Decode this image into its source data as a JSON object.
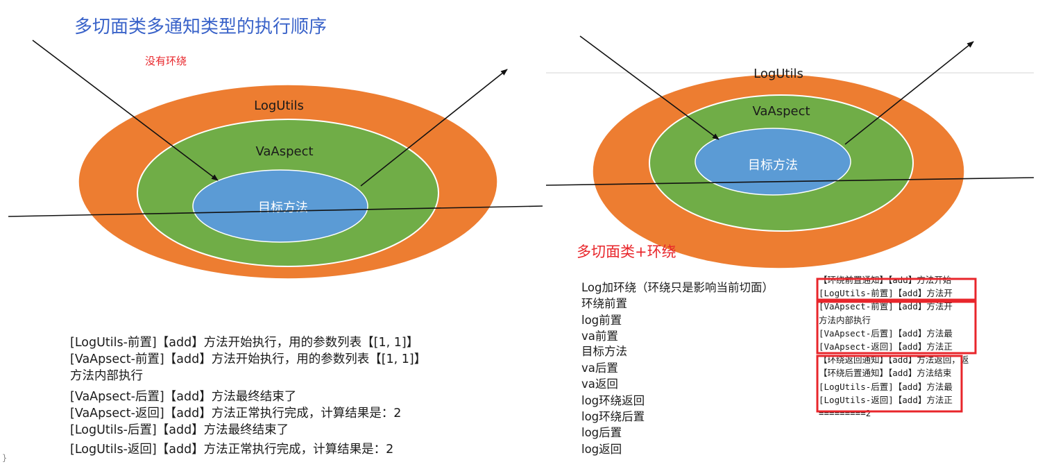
{
  "title": "多切面类多通知类型的执行顺序",
  "left": {
    "note": "没有环绕",
    "outer_label": "LogUtils",
    "middle_label": "VaAspect",
    "core_label": "目标方法",
    "log_lines": [
      "[LogUtils-前置]【add】方法开始执行，用的参数列表【[1, 1]】",
      "[VaApsect-前置]【add】方法开始执行，用的参数列表【[1, 1]】",
      "方法内部执行",
      "[VaApsect-后置]【add】方法最终结束了",
      "[VaApsect-返回]【add】方法正常执行完成，计算结果是：2",
      "[LogUtils-后置]【add】方法最终结束了",
      "[LogUtils-返回]【add】方法正常执行完成，计算结果是：2"
    ]
  },
  "right": {
    "outer_label": "LogUtils",
    "middle_label": "VaAspect",
    "core_label": "目标方法",
    "heading": "多切面类+环绕",
    "sequence": [
      "Log加环绕（环绕只是影响当前切面）",
      "环绕前置",
      "log前置",
      "va前置",
      "目标方法",
      "va后置",
      "va返回",
      "log环绕返回",
      "log环绕后置",
      "log后置",
      "log返回"
    ],
    "console_lines": [
      "【环绕前置通知】【add】方法开始",
      "[LogUtils-前置]【add】方法开",
      "[VaApsect-前置]【add】方法开",
      "方法内部执行",
      "[VaApsect-后置]【add】方法最",
      "[VaApsect-返回]【add】方法正",
      "【环绕返回通知】【add】方法返回，返",
      "【环绕后置通知】【add】方法结束",
      "[LogUtils-后置]【add】方法最",
      "[LogUtils-返回]【add】方法正",
      "=========2"
    ]
  },
  "colors": {
    "outer": "#ed7d31",
    "middle": "#70ad47",
    "core": "#5b9bd5",
    "title": "#3a63c9",
    "highlight": "#e8262b"
  },
  "stray_brace": "}"
}
